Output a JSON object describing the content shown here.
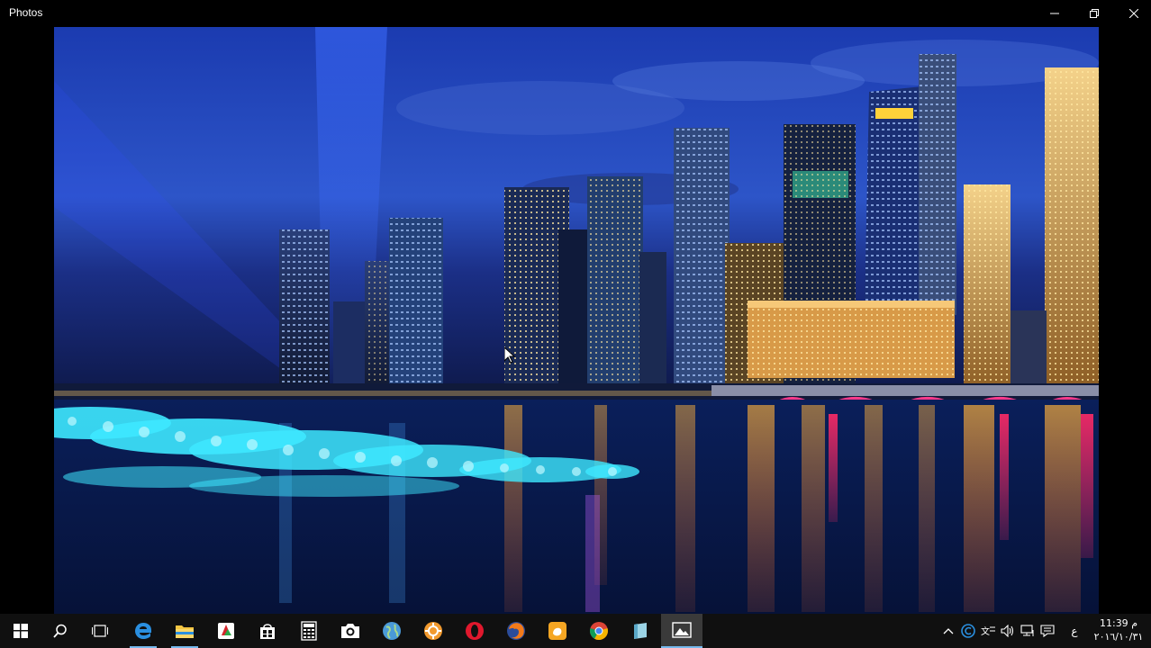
{
  "window": {
    "title": "Photos"
  },
  "taskbar": {
    "items": [
      {
        "name": "start-button",
        "icon": "windows-logo-icon"
      },
      {
        "name": "search-button",
        "icon": "search-icon"
      },
      {
        "name": "task-view-button",
        "icon": "task-view-icon"
      },
      {
        "name": "edge-button",
        "icon": "edge-icon"
      },
      {
        "name": "file-explorer-button",
        "icon": "folder-icon"
      },
      {
        "name": "media-app-button",
        "icon": "media-icon"
      },
      {
        "name": "store-button",
        "icon": "store-icon"
      },
      {
        "name": "calculator-button",
        "icon": "calculator-icon"
      },
      {
        "name": "camera-button",
        "icon": "camera-icon"
      },
      {
        "name": "globe-app-button",
        "icon": "globe-icon"
      },
      {
        "name": "orange-app-button",
        "icon": "gear-icon"
      },
      {
        "name": "opera-button",
        "icon": "opera-icon"
      },
      {
        "name": "firefox-button",
        "icon": "firefox-icon"
      },
      {
        "name": "uc-browser-button",
        "icon": "uc-browser-icon"
      },
      {
        "name": "chrome-button",
        "icon": "chrome-icon"
      },
      {
        "name": "notes-app-button",
        "icon": "notes-icon"
      },
      {
        "name": "photos-button",
        "icon": "photos-icon"
      }
    ],
    "tray": {
      "language": "ع",
      "time": "11:39 م",
      "date": "٢٠١٦/١٠/٣١"
    }
  },
  "colors": {
    "taskbar_bg": "#101010",
    "active_indicator": "#76b9ed",
    "window_bg": "#000000"
  }
}
